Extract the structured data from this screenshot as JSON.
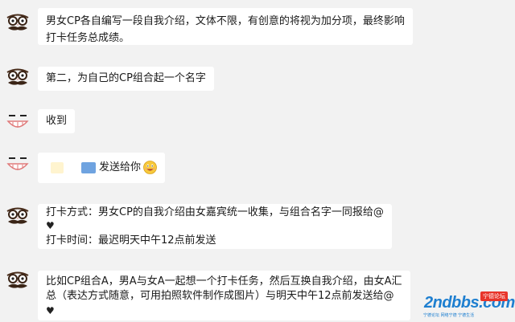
{
  "messages": [
    {
      "avatar": "glasses-mustache-avatar",
      "lines": [
        "男女CP各自编写一段自我介绍，文体不限，有创意的将视为加分项，最终影响",
        "打卡任务总成绩。"
      ]
    },
    {
      "avatar": "glasses-mustache-avatar",
      "lines": [
        "第二，为自己的CP组合起一个名字"
      ]
    },
    {
      "avatar": "smiling-face-avatar",
      "lines": [
        "收到"
      ]
    },
    {
      "avatar": "smiling-face-avatar",
      "text": "发送给你"
    },
    {
      "avatar": "glasses-mustache-avatar",
      "lines": [
        "打卡方式：男女CP的自我介绍由女嘉宾统一收集，与组合名字一同报给@",
        "♥",
        "打卡时间：最迟明天中午12点前发送"
      ]
    },
    {
      "avatar": "glasses-mustache-avatar",
      "lines": [
        "比如CP组合A，男A与女A一起想一个打卡任务，然后互换自我介绍，由女A汇",
        "总（表达方式随意，可用拍照软件制作成图片）与明天中午12点前发送给@",
        "♥"
      ]
    }
  ],
  "watermark": {
    "main": "2ndbbs.com",
    "tag": "宁德论坛",
    "sub": "宁德论坛 网络宁德 宁德生活"
  }
}
